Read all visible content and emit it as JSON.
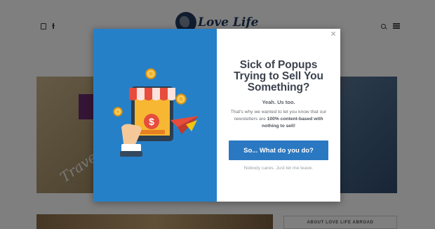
{
  "site": {
    "logo_text": "Love Life",
    "about_heading": "ABOUT LOVE LIFE ABROAD",
    "hero_tagline": "Travel"
  },
  "social": {
    "icons": [
      "instagram-icon",
      "facebook-icon"
    ]
  },
  "header_actions": {
    "icons": [
      "search-icon",
      "menu-icon"
    ]
  },
  "popup": {
    "close_label": "×",
    "title_lines": [
      "Sick of Popups",
      "Trying to Sell You",
      "Something?"
    ],
    "subhead": "Yeah. Us too.",
    "body_prefix": "That's why we wanted to let you know that our newsletters are ",
    "body_bold": "100% content-based with nothing to sell!",
    "cta_label": "So... What do you do?",
    "dismiss_label": "Nobody cares. Just let me leave."
  },
  "colors": {
    "popup_left_bg": "#2680c8",
    "cta_bg": "#2b78c2",
    "title_text": "#3c434e",
    "overlay": "rgba(0,0,0,0.50)"
  },
  "illustration": {
    "description_icons": [
      "shop-tablet-icon",
      "dollar-sign-icon",
      "coin-icon",
      "paper-plane-icon",
      "hand-icon"
    ]
  }
}
